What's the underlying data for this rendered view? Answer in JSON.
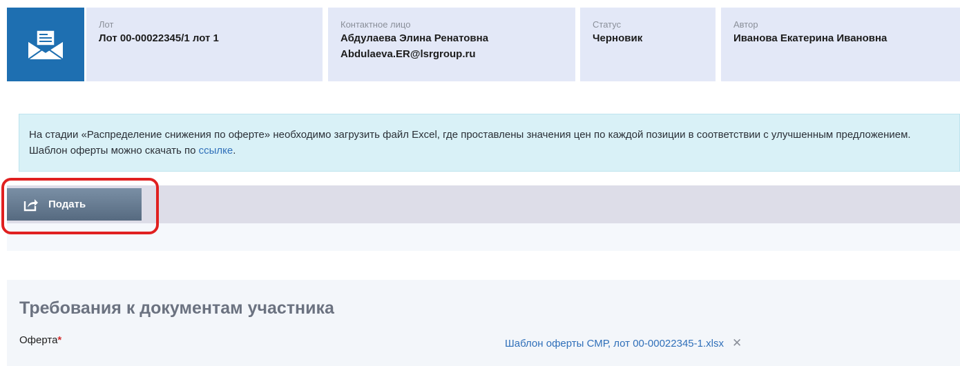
{
  "header": {
    "icon": "envelope-icon",
    "lot": {
      "label": "Лот",
      "value": "Лот 00-00022345/1 лот 1"
    },
    "contact": {
      "label": "Контактное лицо",
      "name": "Абдулаева Элина Ренатовна",
      "email": "Abdulaeva.ER@lsrgroup.ru"
    },
    "status": {
      "label": "Статус",
      "value": "Черновик"
    },
    "author": {
      "label": "Автор",
      "value": "Иванова Екатерина Ивановна"
    }
  },
  "notice": {
    "text_before_link": "На стадии «Распределение снижения по оферте» необходимо загрузить файл Excel, где проставлены значения цен по каждой позиции в соответствии с улучшенным предложением. Шаблон оферты можно скачать по ",
    "link_text": "ссылке",
    "text_after_link": "."
  },
  "toolbar": {
    "submit_label": "Подать",
    "submit_icon": "share-icon"
  },
  "requirements": {
    "title": "Требования к документам участника",
    "field_label": "Оферта",
    "required_mark": "*",
    "file_name": "Шаблон оферты СМР, лот 00-00022345-1.xlsx",
    "remove_symbol": "✕"
  },
  "colors": {
    "header_icon_bg": "#1e6fb1",
    "card_bg": "#e3e8f7",
    "notice_bg": "#d9f1f7",
    "link": "#2f6fb9",
    "highlight": "#e02020"
  }
}
